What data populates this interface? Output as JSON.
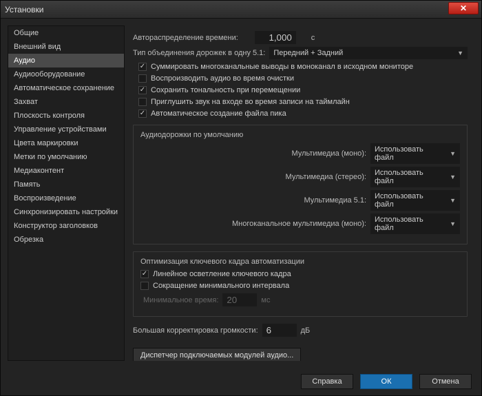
{
  "window": {
    "title": "Установки"
  },
  "sidebar": [
    "Общие",
    "Внешний вид",
    "Аудио",
    "Аудиооборудование",
    "Автоматическое сохранение",
    "Захват",
    "Плоскость контроля",
    "Управление устройствами",
    "Цвета маркировки",
    "Метки по умолчанию",
    "Медиаконтент",
    "Память",
    "Воспроизведение",
    "Синхронизировать настройки",
    "Конструктор заголовков",
    "Обрезка"
  ],
  "main": {
    "autoTime": {
      "label": "Автораспределение времени:",
      "value": "1,000",
      "unit": "с"
    },
    "mixdown": {
      "label": "Тип объединения дорожек в одну 5.1:",
      "value": "Передний + Задний"
    },
    "cb": {
      "sum_mono": "Суммировать многоканальные выводы в моноканал в исходном мониторе",
      "play_scrub": "Воспроизводить аудио во время очистки",
      "pitch": "Сохранить тональность при перемещении",
      "mute_input": "Приглушить звук на входе во время записи на таймлайн",
      "auto_peak": "Автоматическое создание файла пика"
    },
    "defaultTracks": {
      "title": "Аудиодорожки по умолчанию",
      "mono": {
        "label": "Мультимедиа (моно):",
        "value": "Использовать файл"
      },
      "stereo": {
        "label": "Мультимедиа (стерео):",
        "value": "Использовать файл"
      },
      "s51": {
        "label": "Мультимедиа 5.1:",
        "value": "Использовать файл"
      },
      "multi": {
        "label": "Многоканальное мультимедиа (моно):",
        "value": "Использовать файл"
      }
    },
    "keyframe": {
      "title": "Оптимизация ключевого кадра автоматизации",
      "linear": "Линейное осветление ключевого кадра",
      "reduce": "Сокращение минимального интервала",
      "minTime": {
        "label": "Минимальное время:",
        "value": "20",
        "unit": "мс"
      }
    },
    "largeVolume": {
      "label": "Большая корректировка громкости:",
      "value": "6",
      "unit": "дБ"
    },
    "pluginManager": "Диспетчер подключаемых модулей аудио..."
  },
  "buttons": {
    "help": "Справка",
    "ok": "ОК",
    "cancel": "Отмена"
  }
}
